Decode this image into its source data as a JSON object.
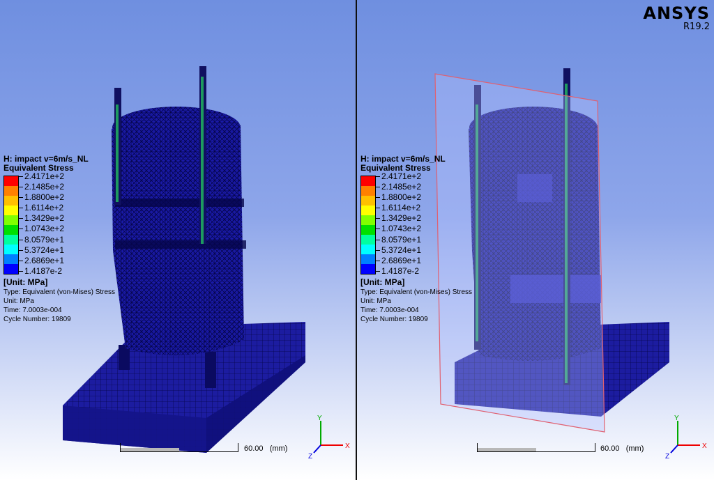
{
  "brand": {
    "name": "ANSYS",
    "version": "R19.2"
  },
  "result": {
    "title": "H: impact v=6m/s_NL",
    "subtitle": "Equivalent Stress",
    "unit_label": "[Unit: MPa]",
    "info": {
      "type": "Type: Equivalent (von-Mises) Stress",
      "unit": "Unit: MPa",
      "time": "Time: 7.0003e-004",
      "cycle": "Cycle Number: 19809"
    }
  },
  "legend": {
    "labels": [
      "2.4171e+2",
      "2.1485e+2",
      "1.8800e+2",
      "1.6114e+2",
      "1.3429e+2",
      "1.0743e+2",
      "8.0579e+1",
      "5.3724e+1",
      "2.6869e+1",
      "1.4187e-2"
    ],
    "colors": [
      "#ff0000",
      "#ff8000",
      "#ffc000",
      "#ffff00",
      "#80ff00",
      "#00e000",
      "#00ffa0",
      "#00ffff",
      "#0080ff",
      "#0000ff"
    ]
  },
  "scale": {
    "label": "60.00",
    "unit": "(mm)"
  },
  "triad": {
    "x": "X",
    "y": "Y",
    "z": "Z"
  }
}
